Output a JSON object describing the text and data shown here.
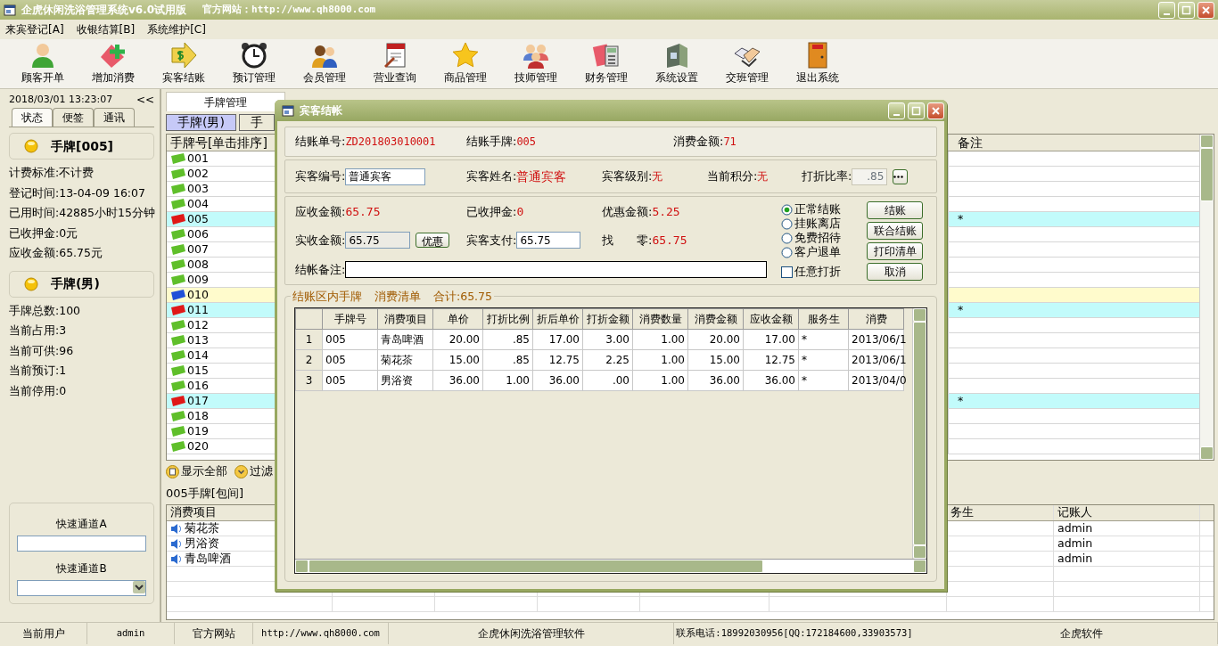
{
  "window": {
    "title": "企虎休闲洗浴管理系统v6.0试用版",
    "site": "官方网站：http://www.qh8000.com"
  },
  "menu": [
    "来宾登记[A]",
    "收银结算[B]",
    "系统维护[C]"
  ],
  "toolbar": [
    {
      "label": "顾客开单",
      "kind": "person"
    },
    {
      "label": "增加消费",
      "kind": "add"
    },
    {
      "label": "宾客结账",
      "kind": "checkout"
    },
    {
      "label": "预订管理",
      "kind": "clock"
    },
    {
      "label": "会员管理",
      "kind": "members"
    },
    {
      "label": "营业查询",
      "kind": "notepad"
    },
    {
      "label": "商品管理",
      "kind": "star"
    },
    {
      "label": "技师管理",
      "kind": "group"
    },
    {
      "label": "财务管理",
      "kind": "finance"
    },
    {
      "label": "系统设置",
      "kind": "settings"
    },
    {
      "label": "交班管理",
      "kind": "handshake"
    },
    {
      "label": "退出系统",
      "kind": "exit"
    }
  ],
  "sidebar": {
    "datetime": "2018/03/01 13:23:07",
    "collapse": "<<",
    "tabs": [
      {
        "label": "状态",
        "selected": true
      },
      {
        "label": "便签",
        "selected": false
      },
      {
        "label": "通讯",
        "selected": false
      }
    ],
    "card_title": "手牌[005]",
    "details": [
      "计费标准:不计费",
      "登记时间:13-04-09 16:07",
      "已用时间:42885小时15分钟",
      "已收押金:0元",
      "应收金额:65.75元"
    ],
    "group_title": "手牌(男)",
    "stats": [
      "手牌总数:100",
      "当前占用:3",
      "当前可供:96",
      "当前预订:1",
      "当前停用:0"
    ],
    "quick": [
      {
        "label": "快速通道A",
        "kind": "input"
      },
      {
        "label": "快速通道B",
        "kind": "select"
      }
    ]
  },
  "main": {
    "tabs": [
      {
        "label": "手牌管理",
        "selected": true
      }
    ],
    "subtabs": [
      {
        "label": "手牌(男)",
        "selected": true
      },
      {
        "label": "手",
        "selected": false
      }
    ],
    "grid": {
      "columns": [
        "手牌号[单击排序]",
        "备注"
      ],
      "rows": [
        {
          "number": "001",
          "color": "#5fbf2a"
        },
        {
          "number": "002",
          "color": "#5fbf2a"
        },
        {
          "number": "003",
          "color": "#5fbf2a"
        },
        {
          "number": "004",
          "color": "#5fbf2a"
        },
        {
          "number": "005",
          "color": "#e01818",
          "note": "*"
        },
        {
          "number": "006",
          "color": "#5fbf2a"
        },
        {
          "number": "007",
          "color": "#5fbf2a"
        },
        {
          "number": "008",
          "color": "#5fbf2a"
        },
        {
          "number": "009",
          "color": "#5fbf2a"
        },
        {
          "number": "010",
          "color": "#1f4fd8"
        },
        {
          "number": "011",
          "color": "#e01818",
          "note": "*"
        },
        {
          "number": "012",
          "color": "#5fbf2a"
        },
        {
          "number": "013",
          "color": "#5fbf2a"
        },
        {
          "number": "014",
          "color": "#5fbf2a"
        },
        {
          "number": "015",
          "color": "#5fbf2a"
        },
        {
          "number": "016",
          "color": "#5fbf2a"
        },
        {
          "number": "017",
          "color": "#e01818",
          "note": "*"
        },
        {
          "number": "018",
          "color": "#5fbf2a"
        },
        {
          "number": "019",
          "color": "#5fbf2a"
        },
        {
          "number": "020",
          "color": "#5fbf2a"
        }
      ]
    },
    "filters": [
      {
        "label": "显示全部",
        "kind": "show"
      },
      {
        "label": "过滤",
        "kind": "filter"
      }
    ],
    "detail_title": "005手牌[包间]",
    "consumption": {
      "columns": [
        "消费项目",
        "务生",
        "记账人"
      ],
      "rows": [
        {
          "item": "菊花茶",
          "clerk": "admin"
        },
        {
          "item": "男浴资",
          "clerk": "admin"
        },
        {
          "item": "青岛啤酒",
          "clerk": "admin"
        }
      ]
    }
  },
  "dialog": {
    "title": "宾客结帐",
    "summary": [
      {
        "label": "结账单号:",
        "value": "ZD201803010001"
      },
      {
        "label": "结账手牌:",
        "value": "005"
      },
      {
        "label": "消费金额:",
        "value": "71"
      }
    ],
    "guest": {
      "id_label": "宾客编号:",
      "id_value": "普通宾客",
      "name_label": "宾客姓名:",
      "name_value": "普通宾客",
      "level_label": "宾客级别:",
      "level_value": "无",
      "points_label": "当前积分:",
      "points_value": "无",
      "discount_label": "打折比率:",
      "discount_value": ".85"
    },
    "amounts": [
      {
        "label": "应收金额:",
        "value": "65.75"
      },
      {
        "label": "已收押金:",
        "value": "0"
      },
      {
        "label": "优惠金额:",
        "value": "5.25"
      }
    ],
    "payment": {
      "actual_label": "实收金额:",
      "actual_value": "65.75",
      "discount_button": "优惠",
      "paid_label": "宾客支付:",
      "paid_value": "65.75",
      "change_label": "找　　零:",
      "change_value": "65.75"
    },
    "remark_label": "结帐备注:",
    "modes": [
      {
        "label": "正常结账",
        "selected": true
      },
      {
        "label": "挂账离店",
        "selected": false
      },
      {
        "label": "免费招待",
        "selected": false
      },
      {
        "label": "客户退单",
        "selected": false
      }
    ],
    "free_discount": {
      "label": "任意打折",
      "checked": false
    },
    "buttons": [
      "结账",
      "联合结账",
      "打印清单",
      "取消"
    ],
    "list": {
      "legend": [
        "结账区内手牌",
        "消费清单",
        "合计:65.75"
      ],
      "columns": [
        "手牌号",
        "消费项目",
        "单价",
        "打折比例",
        "折后单价",
        "打折金额",
        "消费数量",
        "消费金额",
        "应收金额",
        "服务生",
        "消费"
      ],
      "rows": [
        {
          "index": "1",
          "cells": [
            "005",
            "青岛啤酒",
            "20.00",
            ".85",
            "17.00",
            "3.00",
            "1.00",
            "20.00",
            "17.00",
            "*",
            "2013/06/1"
          ]
        },
        {
          "index": "2",
          "cells": [
            "005",
            "菊花茶",
            "15.00",
            ".85",
            "12.75",
            "2.25",
            "1.00",
            "15.00",
            "12.75",
            "*",
            "2013/06/1"
          ]
        },
        {
          "index": "3",
          "cells": [
            "005",
            "男浴资",
            "36.00",
            "1.00",
            "36.00",
            ".00",
            "1.00",
            "36.00",
            "36.00",
            "*",
            "2013/04/0"
          ]
        }
      ]
    }
  },
  "status_bar": [
    "当前用户",
    "admin",
    "官方网站",
    "http://www.qh8000.com",
    "企虎休闲洗浴管理软件",
    "联系电话:18992030956[QQ:172184600,33903573]",
    "企虎软件"
  ]
}
